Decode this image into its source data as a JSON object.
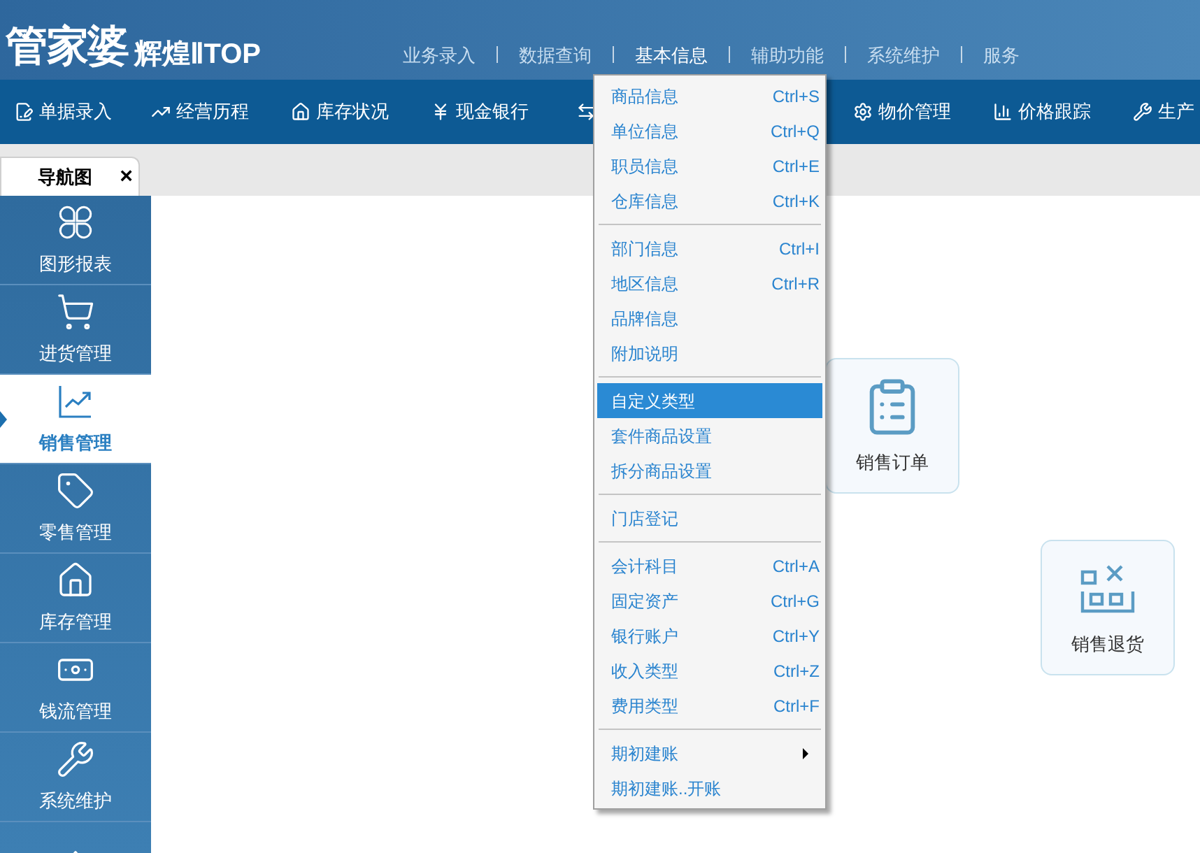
{
  "logo": {
    "brand": "管家婆",
    "edition": "辉煌ⅡTOP"
  },
  "top_nav": [
    {
      "label": "业务录入",
      "selected": false
    },
    {
      "label": "数据查询",
      "selected": false
    },
    {
      "label": "基本信息",
      "selected": true
    },
    {
      "label": "辅助功能",
      "selected": false
    },
    {
      "label": "系统维护",
      "selected": false
    },
    {
      "label": "服务",
      "selected": false
    }
  ],
  "toolbar": [
    {
      "label": "单据录入"
    },
    {
      "label": "经营历程"
    },
    {
      "label": "库存状况"
    },
    {
      "label": "现金银行"
    },
    {
      "label": "物价管理"
    },
    {
      "label": "价格跟踪"
    },
    {
      "label": "生产"
    }
  ],
  "tab": {
    "label": "导航图",
    "close": "×"
  },
  "sidebar": [
    {
      "label": "图形报表",
      "selected": false
    },
    {
      "label": "进货管理",
      "selected": false
    },
    {
      "label": "销售管理",
      "selected": true
    },
    {
      "label": "零售管理",
      "selected": false
    },
    {
      "label": "库存管理",
      "selected": false
    },
    {
      "label": "钱流管理",
      "selected": false
    },
    {
      "label": "系统维护",
      "selected": false
    },
    {
      "selected": false
    }
  ],
  "tiles": [
    {
      "label": "销售订单"
    },
    {
      "label": "销售退货"
    }
  ],
  "menu": [
    {
      "kind": "item",
      "label": "商品信息",
      "shortcut": "Ctrl+S",
      "selected": false
    },
    {
      "kind": "item",
      "label": "单位信息",
      "shortcut": "Ctrl+Q",
      "selected": false
    },
    {
      "kind": "item",
      "label": "职员信息",
      "shortcut": "Ctrl+E",
      "selected": false
    },
    {
      "kind": "item",
      "label": "仓库信息",
      "shortcut": "Ctrl+K",
      "selected": false
    },
    {
      "kind": "separator"
    },
    {
      "kind": "item",
      "label": "部门信息",
      "shortcut": "Ctrl+I",
      "selected": false
    },
    {
      "kind": "item",
      "label": "地区信息",
      "shortcut": "Ctrl+R",
      "selected": false
    },
    {
      "kind": "item",
      "label": "品牌信息",
      "selected": false
    },
    {
      "kind": "item",
      "label": "附加说明",
      "selected": false
    },
    {
      "kind": "separator"
    },
    {
      "kind": "item",
      "label": "自定义类型",
      "selected": true
    },
    {
      "kind": "item",
      "label": "套件商品设置",
      "selected": false
    },
    {
      "kind": "item",
      "label": "拆分商品设置",
      "selected": false
    },
    {
      "kind": "separator"
    },
    {
      "kind": "item",
      "label": "门店登记",
      "selected": false
    },
    {
      "kind": "separator"
    },
    {
      "kind": "item",
      "label": "会计科目",
      "shortcut": "Ctrl+A",
      "selected": false
    },
    {
      "kind": "item",
      "label": "固定资产",
      "shortcut": "Ctrl+G",
      "selected": false
    },
    {
      "kind": "item",
      "label": "银行账户",
      "shortcut": "Ctrl+Y",
      "selected": false
    },
    {
      "kind": "item",
      "label": "收入类型",
      "shortcut": "Ctrl+Z",
      "selected": false
    },
    {
      "kind": "item",
      "label": "费用类型",
      "shortcut": "Ctrl+F",
      "selected": false
    },
    {
      "kind": "separator"
    },
    {
      "kind": "submenu",
      "label": "期初建账",
      "selected": false
    },
    {
      "kind": "item",
      "label": "期初建账..开账",
      "selected": false
    }
  ]
}
